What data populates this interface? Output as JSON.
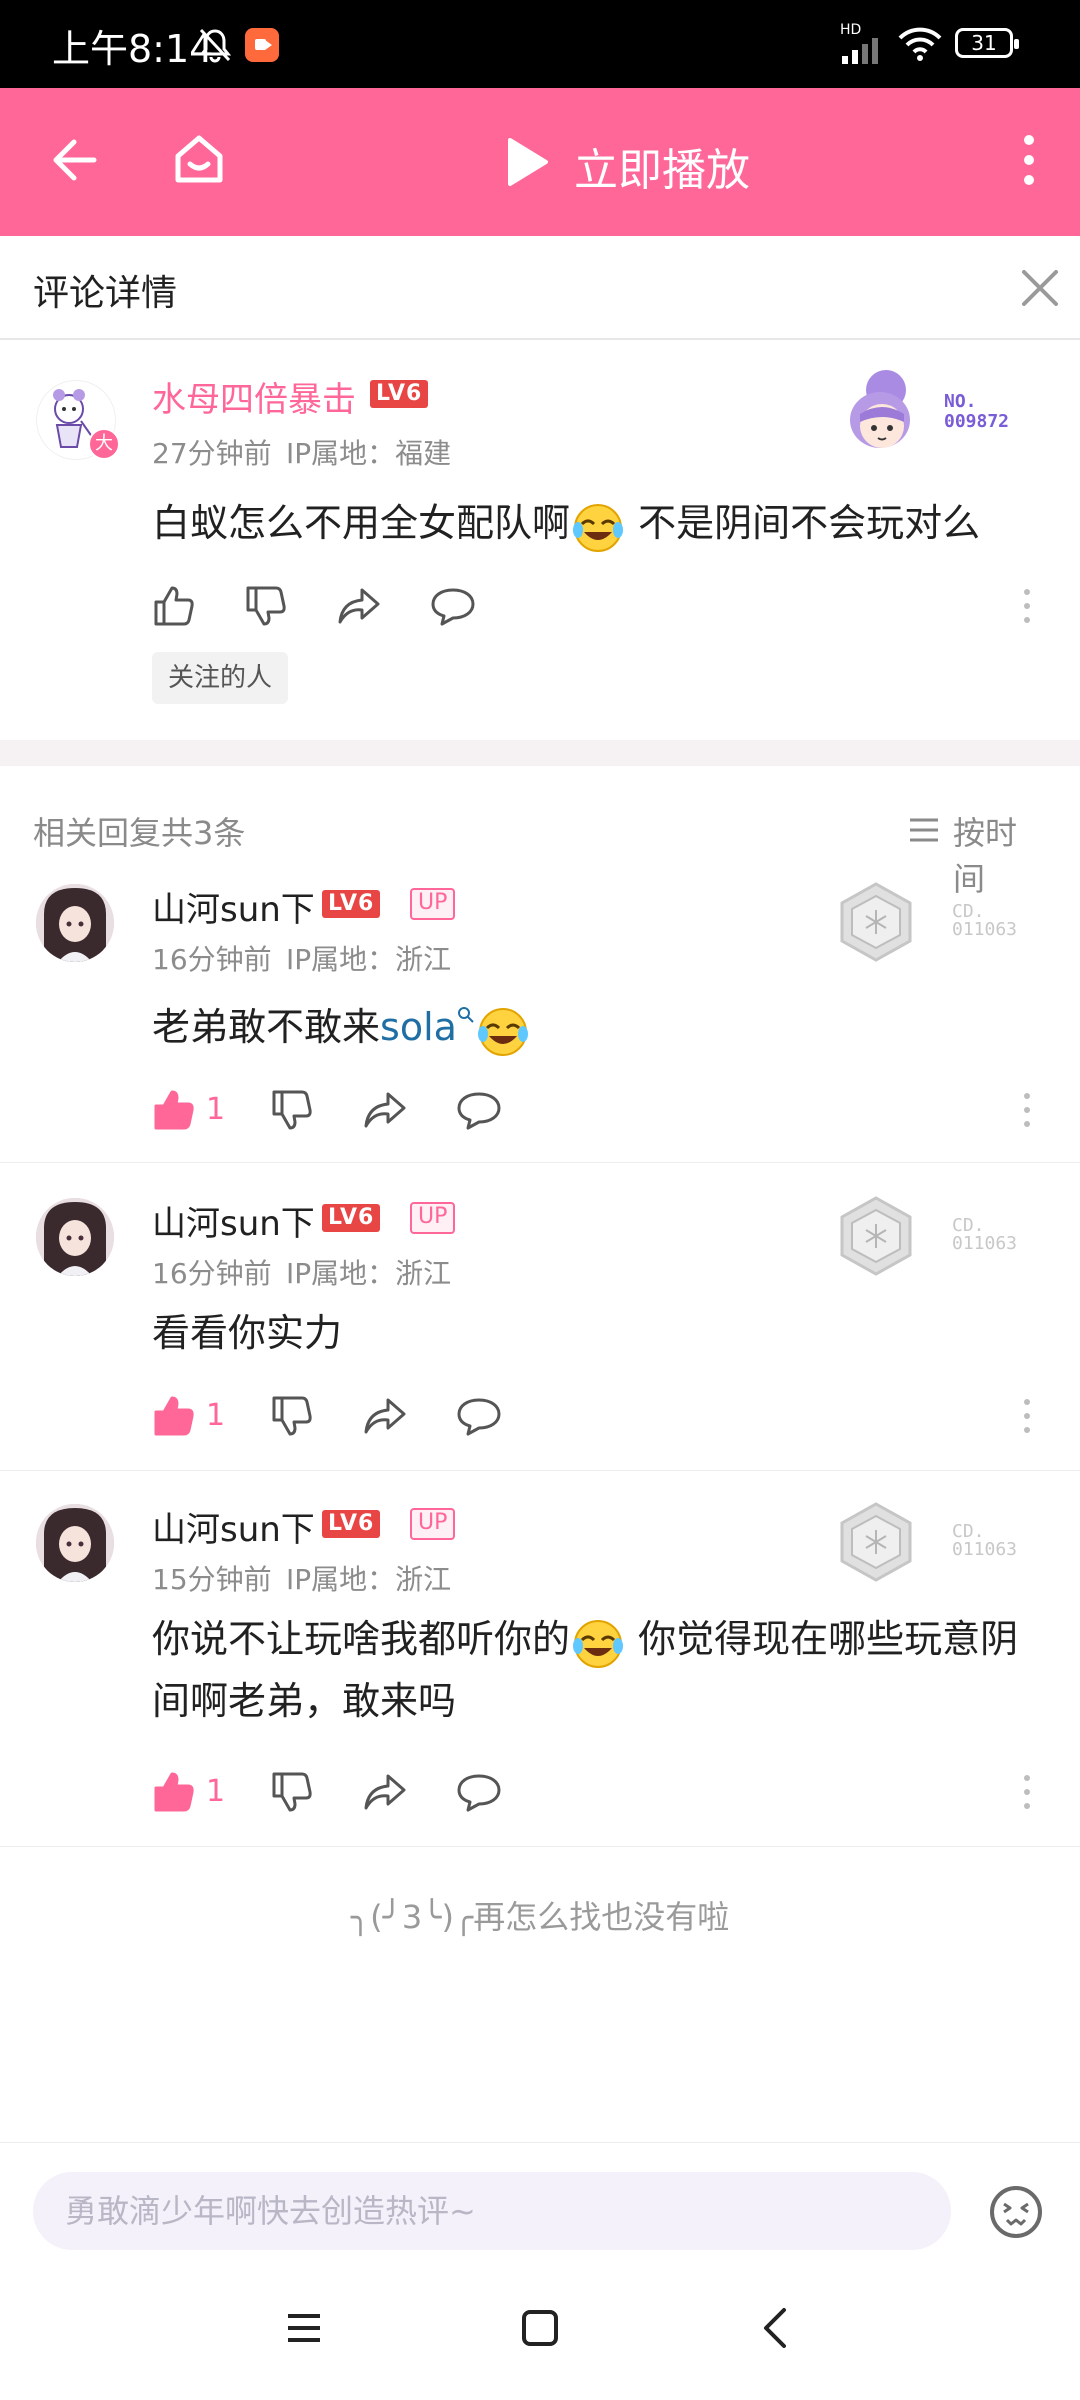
{
  "status_bar": {
    "time": "上午8:14",
    "battery": "31",
    "network": "HD"
  },
  "top_bar": {
    "play_label": "立即播放"
  },
  "detail": {
    "title": "评论详情"
  },
  "main_comment": {
    "username": "水母四倍暴击",
    "level": "LV6",
    "meta_time": "27分钟前",
    "meta_ip": "IP属地：福建",
    "content_a": "白蚁怎么不用全女配队啊",
    "content_b": "不是阴间不会玩对么",
    "tag": "关注的人",
    "medal_no_label": "NO.",
    "medal_no_value": "009872",
    "avatar_badge": "大"
  },
  "replies_header": {
    "count_label": "相关回复共3条",
    "sort_label": "按时间"
  },
  "replies": [
    {
      "username": "山河sun下",
      "level": "LV6",
      "up": "UP",
      "meta_time": "16分钟前",
      "meta_ip": "IP属地：浙江",
      "content_a": "老弟敢不敢来",
      "content_link": "sola",
      "likes": "1",
      "medal_cd_label": "CD.",
      "medal_cd_value": "011063"
    },
    {
      "username": "山河sun下",
      "level": "LV6",
      "up": "UP",
      "meta_time": "16分钟前",
      "meta_ip": "IP属地：浙江",
      "content_a": "看看你实力",
      "likes": "1",
      "medal_cd_label": "CD.",
      "medal_cd_value": "011063"
    },
    {
      "username": "山河sun下",
      "level": "LV6",
      "up": "UP",
      "meta_time": "15分钟前",
      "meta_ip": "IP属地：浙江",
      "content_a": "你说不让玩啥我都听你的",
      "content_b": "你觉得现在哪些玩意阴",
      "content_c": "间啊老弟，敢来吗",
      "likes": "1",
      "medal_cd_label": "CD.",
      "medal_cd_value": "011063"
    }
  ],
  "end_text": "╮(╯3╰)╭再怎么找也没有啦",
  "input": {
    "placeholder": "勇敢滴少年啊快去创造热评~"
  },
  "colors": {
    "accent": "#fe6797",
    "level_badge": "#e84545",
    "medal_purple": "#7a5cd6"
  }
}
